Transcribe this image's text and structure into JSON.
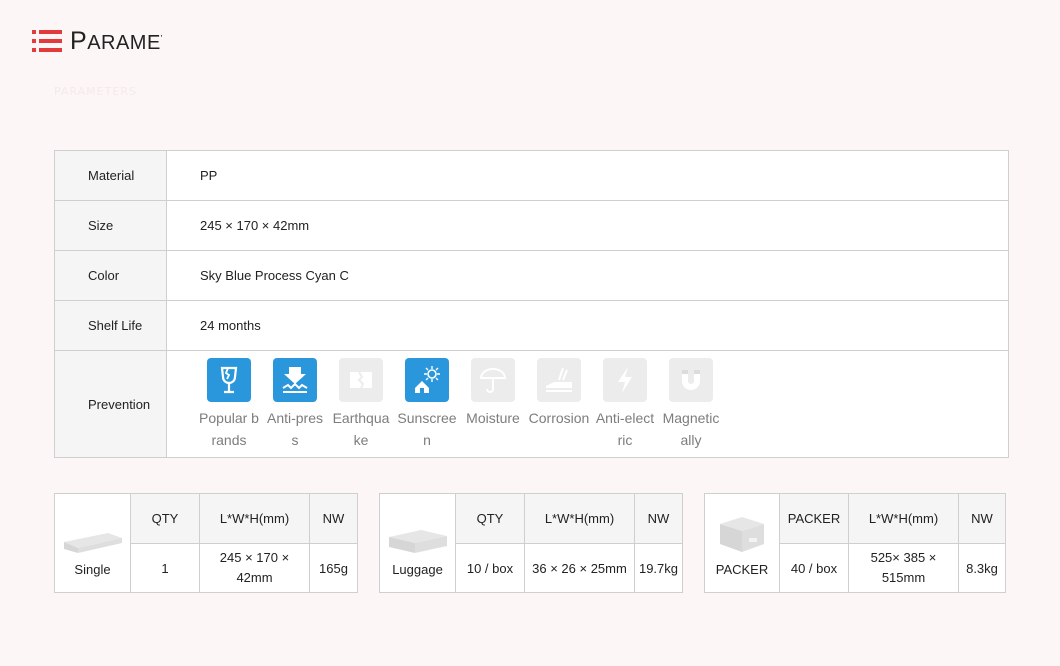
{
  "header": {
    "title_first": "P",
    "title_rest": "ARAMETERS",
    "subtitle": "PARAMETERS"
  },
  "colors": {
    "accent": "#e23b3b",
    "icon_active": "#2a97dc",
    "icon_inactive": "#ececec"
  },
  "spec": {
    "rows": [
      {
        "key": "Material",
        "value": "PP"
      },
      {
        "key": "Size",
        "value": "245 × 170 × 42mm"
      },
      {
        "key": "Color",
        "value": "Sky Blue Process Cyan C"
      },
      {
        "key": "Shelf Life",
        "value": "24 months"
      }
    ],
    "prevention_label": "Prevention",
    "prevention": [
      {
        "icon": "broken-glass-icon",
        "label": "Popular brands",
        "active": true
      },
      {
        "icon": "anti-press-icon",
        "label": "Anti-press",
        "active": true
      },
      {
        "icon": "earthquake-icon",
        "label": "Earthquake",
        "active": false
      },
      {
        "icon": "sunscreen-icon",
        "label": "Sunscreen",
        "active": true
      },
      {
        "icon": "umbrella-icon",
        "label": "Moisture",
        "active": false
      },
      {
        "icon": "corrosion-icon",
        "label": "Corrosion",
        "active": false
      },
      {
        "icon": "lightning-icon",
        "label": "Anti-electric",
        "active": false
      },
      {
        "icon": "magnet-icon",
        "label": "Magnetically",
        "active": false
      }
    ]
  },
  "packages": [
    {
      "caption": "Single",
      "headers": [
        "QTY",
        "L*W*H(mm)",
        "NW"
      ],
      "values": [
        "1",
        "245 × 170 × 42mm",
        "165g"
      ],
      "icon": "flat-box-icon"
    },
    {
      "caption": "Luggage",
      "headers": [
        "QTY",
        "L*W*H(mm)",
        "NW"
      ],
      "values": [
        "10 / box",
        "36 × 26 × 25mm",
        "19.7kg"
      ],
      "icon": "case-icon"
    },
    {
      "caption": "PACKER",
      "headers": [
        "PACKER",
        "L*W*H(mm)",
        "NW"
      ],
      "values": [
        "40 / box",
        "525× 385 × 515mm",
        "8.3kg"
      ],
      "icon": "carton-box-icon"
    }
  ]
}
